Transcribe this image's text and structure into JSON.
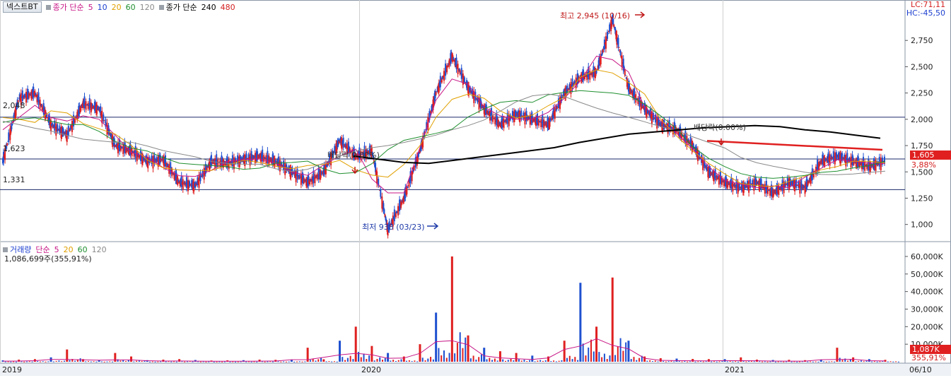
{
  "title_button": "넥스트BT",
  "legend_main": {
    "ma_label": "종가 단순",
    "periods": [
      {
        "label": "5",
        "color": "#c71585"
      },
      {
        "label": "10",
        "color": "#1a3fd0"
      },
      {
        "label": "20",
        "color": "#e0a000"
      },
      {
        "label": "60",
        "color": "#1f8f2f"
      },
      {
        "label": "120",
        "color": "#8a8a8a"
      }
    ],
    "ma_label2": "종가 단순",
    "periods2": [
      {
        "label": "240",
        "color": "#000000"
      },
      {
        "label": "480",
        "color": "#d42020"
      }
    ]
  },
  "legend_volume": {
    "label": "거래량",
    "ma_label": "단순",
    "periods": [
      {
        "label": "5",
        "color": "#c71585"
      },
      {
        "label": "20",
        "color": "#e0a000"
      },
      {
        "label": "60",
        "color": "#1f8f2f"
      },
      {
        "label": "120",
        "color": "#8a8a8a"
      }
    ],
    "info": "1,086,699주(355,91%)"
  },
  "right_top": {
    "lc": "LC:71,11",
    "hc": "HC:-45,50"
  },
  "price_annotations": {
    "high": "최고 2,945 (10/16)",
    "low": "최저 938 (03/23)",
    "dividend1": "배당락(0.00%)",
    "dividend2": "배당락(0.00%)",
    "level_2048": "2,048",
    "level_1623": "1,623",
    "level_1331": "1,331",
    "current": "1,605",
    "current_pct": "3,88%",
    "volume_current": "1,087K",
    "volume_pct": "355,91%"
  },
  "colors": {
    "up": "#e02020",
    "down": "#1f50d0",
    "grid": "#d8d8d8"
  },
  "chart_data": [
    {
      "type": "line",
      "title": "넥스트BT",
      "x": [
        "2019",
        "2020",
        "2021",
        "06/10"
      ],
      "ylim": [
        850,
        3000
      ],
      "y_ticks": [
        1000,
        1250,
        1500,
        1750,
        2000,
        2250,
        2500,
        2750
      ],
      "y_tick_labels": [
        "1,000",
        "1,250",
        "1,500",
        "1,750",
        "2,000",
        "2,250",
        "2,500",
        "2,750"
      ],
      "horizontal_levels": [
        2020,
        1623,
        1331
      ],
      "series": [
        {
          "name": "종가",
          "values": [
            1600,
            2200,
            2250,
            1950,
            1850,
            2150,
            2100,
            1750,
            1700,
            1600,
            1620,
            1400,
            1370,
            1600,
            1580,
            1620,
            1650,
            1600,
            1500,
            1400,
            1500,
            1800,
            1650,
            1700,
            950,
            1250,
            1700,
            2250,
            2600,
            2300,
            2100,
            1950,
            2050,
            2000,
            1950,
            2250,
            2400,
            2450,
            2950,
            2300,
            2100,
            1950,
            1900,
            1750,
            1500,
            1400,
            1350,
            1400,
            1300,
            1400,
            1350,
            1600,
            1650,
            1600,
            1550,
            1605
          ]
        },
        {
          "name": "240",
          "values": [
            1650,
            1620,
            1590,
            1580,
            1610,
            1640,
            1670,
            1700,
            1730,
            1780,
            1820,
            1860,
            1880,
            1900,
            1920,
            1930,
            1940,
            1930,
            1900,
            1880,
            1850,
            1820
          ]
        }
      ]
    },
    {
      "type": "bar",
      "title": "거래량",
      "x": [
        "2019",
        "2020",
        "2021",
        "06/10"
      ],
      "ylim": [
        0,
        62000
      ],
      "y_ticks": [
        10000,
        20000,
        30000,
        40000,
        50000,
        60000
      ],
      "y_tick_labels": [
        "10,000K",
        "20,000K",
        "30,000K",
        "40,000K",
        "50,000K",
        "60,000K"
      ],
      "values": [
        800,
        1200,
        1500,
        2500,
        7000,
        1500,
        1000,
        5000,
        3000,
        900,
        1200,
        1500,
        1000,
        700,
        800,
        900,
        1200,
        1100,
        1000,
        8000,
        1400,
        12000,
        20000,
        9000,
        5000,
        3000,
        10000,
        28000,
        60000,
        15000,
        8000,
        6000,
        5000,
        3500,
        3000,
        12000,
        45000,
        20000,
        48000,
        12000,
        3000,
        2000,
        1800,
        1600,
        1500,
        1500,
        2500,
        1200,
        1000,
        1100,
        900,
        1000,
        8000,
        2500,
        1500,
        1087
      ]
    }
  ]
}
